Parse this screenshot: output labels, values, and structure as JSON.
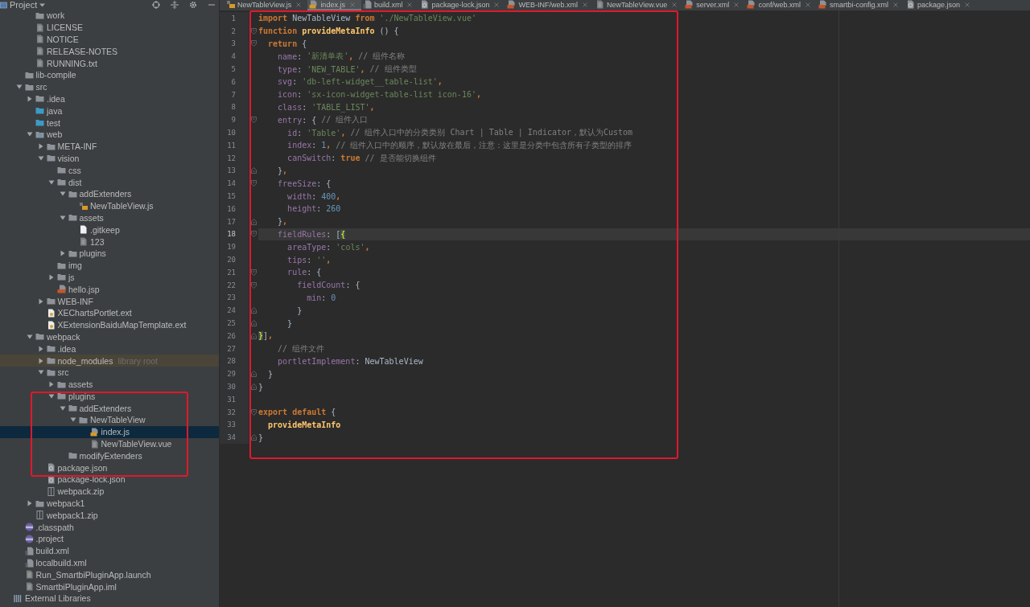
{
  "sidebar": {
    "title": "Project",
    "tree": {
      "cut_branch": [
        {
          "label": "work",
          "kind": "folder",
          "selected": false
        },
        {
          "label": "LICENSE",
          "kind": "text",
          "selected": false
        },
        {
          "label": "NOTICE",
          "kind": "text",
          "selected": false
        },
        {
          "label": "RELEASE-NOTES",
          "kind": "text",
          "selected": false
        },
        {
          "label": "RUNNING.txt",
          "kind": "text",
          "selected": false
        }
      ],
      "project_items": [
        {
          "label": "lib-compile",
          "kind": "folder",
          "selected": false
        },
        {
          "label": "src",
          "kind": "folder",
          "expanded": true,
          "selected": false,
          "children": [
            {
              "label": ".idea",
              "kind": "folder",
              "expanded": false,
              "selected": false
            },
            {
              "label": "java",
              "kind": "source-folder",
              "selected": false
            },
            {
              "label": "test",
              "kind": "source-folder",
              "selected": false
            },
            {
              "label": "web",
              "kind": "web-folder",
              "expanded": true,
              "selected": false,
              "children": [
                {
                  "label": "META-INF",
                  "kind": "folder",
                  "expanded": false,
                  "selected": false
                },
                {
                  "label": "vision",
                  "kind": "folder",
                  "expanded": true,
                  "selected": false,
                  "children": [
                    {
                      "label": "css",
                      "kind": "folder",
                      "selected": false
                    },
                    {
                      "label": "dist",
                      "kind": "folder",
                      "expanded": true,
                      "selected": false,
                      "children": [
                        {
                          "label": "addExtenders",
                          "kind": "folder",
                          "expanded": true,
                          "selected": false,
                          "children": [
                            {
                              "label": "NewTableView.js",
                              "kind": "binary",
                              "selected": false
                            }
                          ]
                        },
                        {
                          "label": "assets",
                          "kind": "folder",
                          "expanded": true,
                          "selected": false,
                          "children": [
                            {
                              "label": ".gitkeep",
                              "kind": "blank",
                              "selected": false
                            },
                            {
                              "label": "123",
                              "kind": "text",
                              "selected": false
                            }
                          ]
                        },
                        {
                          "label": "plugins",
                          "kind": "folder",
                          "expanded": false,
                          "selected": false
                        }
                      ]
                    },
                    {
                      "label": "img",
                      "kind": "folder",
                      "selected": false
                    },
                    {
                      "label": "js",
                      "kind": "folder",
                      "expanded": false,
                      "selected": false
                    },
                    {
                      "label": "hello.jsp",
                      "kind": "jsp",
                      "selected": false
                    }
                  ]
                },
                {
                  "label": "WEB-INF",
                  "kind": "folder",
                  "expanded": false,
                  "selected": false
                },
                {
                  "label": "XEChartsPortlet.ext",
                  "kind": "ext",
                  "selected": false
                },
                {
                  "label": "XExtensionBaiduMapTemplate.ext",
                  "kind": "ext",
                  "selected": false
                }
              ]
            },
            {
              "label": "webpack",
              "kind": "folder",
              "expanded": true,
              "selected": false,
              "children": [
                {
                  "label": ".idea",
                  "kind": "folder",
                  "expanded": false,
                  "selected": false
                },
                {
                  "label": "node_modules",
                  "kind": "folder",
                  "expanded": false,
                  "selected": false,
                  "note": "library root"
                },
                {
                  "label": "src",
                  "kind": "folder",
                  "expanded": true,
                  "selected": false,
                  "children": [
                    {
                      "label": "assets",
                      "kind": "folder",
                      "expanded": false,
                      "selected": false
                    },
                    {
                      "label": "plugins",
                      "kind": "folder",
                      "expanded": true,
                      "selected": false,
                      "children": [
                        {
                          "label": "addExtenders",
                          "kind": "folder",
                          "expanded": true,
                          "selected": false,
                          "children": [
                            {
                              "label": "NewTableView",
                              "kind": "folder",
                              "expanded": true,
                              "selected": false,
                              "children": [
                                {
                                  "label": "index.js",
                                  "kind": "js",
                                  "selected": true
                                },
                                {
                                  "label": "NewTableView.vue",
                                  "kind": "text",
                                  "selected": false
                                }
                              ]
                            }
                          ]
                        },
                        {
                          "label": "modifyExtenders",
                          "kind": "folder",
                          "selected": false
                        }
                      ]
                    }
                  ]
                },
                {
                  "label": "package.json",
                  "kind": "json",
                  "selected": false
                },
                {
                  "label": "package-lock.json",
                  "kind": "json",
                  "selected": false
                },
                {
                  "label": "webpack.zip",
                  "kind": "zip",
                  "selected": false
                }
              ]
            },
            {
              "label": "webpack1",
              "kind": "folder",
              "expanded": false,
              "selected": false
            },
            {
              "label": "webpack1.zip",
              "kind": "zip",
              "selected": false
            }
          ]
        },
        {
          "label": ".classpath",
          "kind": "eclipse",
          "selected": false
        },
        {
          "label": ".project",
          "kind": "eclipse",
          "selected": false
        },
        {
          "label": "build.xml",
          "kind": "build",
          "selected": false
        },
        {
          "label": "localbuild.xml",
          "kind": "build",
          "selected": false
        },
        {
          "label": "Run_SmartbiPluginApp.launch",
          "kind": "text",
          "selected": false
        },
        {
          "label": "SmartbiPluginApp.iml",
          "kind": "iml",
          "selected": false
        }
      ],
      "libraries": [
        {
          "label": "External Libraries",
          "kind": "library",
          "selected": false
        }
      ]
    }
  },
  "tabs": [
    {
      "label": "NewTableView.js",
      "kind": "binary",
      "selected": false
    },
    {
      "label": "index.js",
      "kind": "js",
      "selected": true
    },
    {
      "label": "build.xml",
      "kind": "build",
      "selected": false
    },
    {
      "label": "package-lock.json",
      "kind": "json",
      "selected": false
    },
    {
      "label": "WEB-INF/web.xml",
      "kind": "webxml",
      "selected": false
    },
    {
      "label": "NewTableView.vue",
      "kind": "text",
      "selected": false
    },
    {
      "label": "server.xml",
      "kind": "xml",
      "selected": false
    },
    {
      "label": "conf/web.xml",
      "kind": "webxml",
      "selected": false
    },
    {
      "label": "smartbi-config.xml",
      "kind": "xml",
      "selected": false
    },
    {
      "label": "package.json",
      "kind": "json",
      "selected": false
    }
  ],
  "code": {
    "lines": [
      {
        "n": "1",
        "current": false,
        "fold_open": false,
        "fold_close": false,
        "tokens": [
          {
            "kind": "kw",
            "text": "import"
          },
          {
            "kind": "txt",
            "text": " NewTableView "
          },
          {
            "kind": "kw",
            "text": "from"
          },
          {
            "kind": "str",
            "text": " './NewTableView.vue'"
          }
        ]
      },
      {
        "n": "2",
        "current": false,
        "fold_open": true,
        "fold_close": false,
        "tokens": [
          {
            "kind": "kw",
            "text": "function"
          },
          {
            "kind": "fn",
            "text": " provideMetaInfo"
          },
          {
            "kind": "txt",
            "text": " () {"
          }
        ]
      },
      {
        "n": "3",
        "current": false,
        "fold_open": true,
        "fold_close": false,
        "tokens": [
          {
            "kind": "kw",
            "text": "  return"
          },
          {
            "kind": "txt",
            "text": " {"
          }
        ]
      },
      {
        "n": "4",
        "current": false,
        "fold_open": false,
        "fold_close": false,
        "tokens": [
          {
            "kind": "prop",
            "text": "    name"
          },
          {
            "kind": "txt",
            "text": ": "
          },
          {
            "kind": "str",
            "text": "'新清单表'"
          },
          {
            "kind": "kw",
            "text": ","
          },
          {
            "kind": "com",
            "text": " // 组件名称"
          }
        ]
      },
      {
        "n": "5",
        "current": false,
        "fold_open": false,
        "fold_close": false,
        "tokens": [
          {
            "kind": "prop",
            "text": "    type"
          },
          {
            "kind": "txt",
            "text": ": "
          },
          {
            "kind": "str",
            "text": "'NEW_TABLE'"
          },
          {
            "kind": "kw",
            "text": ","
          },
          {
            "kind": "com",
            "text": " // 组件类型"
          }
        ]
      },
      {
        "n": "6",
        "current": false,
        "fold_open": false,
        "fold_close": false,
        "tokens": [
          {
            "kind": "prop",
            "text": "    svg"
          },
          {
            "kind": "txt",
            "text": ": "
          },
          {
            "kind": "str",
            "text": "'db-left-widget__table-list'"
          },
          {
            "kind": "kw",
            "text": ","
          }
        ]
      },
      {
        "n": "7",
        "current": false,
        "fold_open": false,
        "fold_close": false,
        "tokens": [
          {
            "kind": "prop",
            "text": "    icon"
          },
          {
            "kind": "txt",
            "text": ": "
          },
          {
            "kind": "str",
            "text": "'sx-icon-widget-table-list icon-16'"
          },
          {
            "kind": "kw",
            "text": ","
          }
        ]
      },
      {
        "n": "8",
        "current": false,
        "fold_open": false,
        "fold_close": false,
        "tokens": [
          {
            "kind": "prop",
            "text": "    class"
          },
          {
            "kind": "txt",
            "text": ": "
          },
          {
            "kind": "str",
            "text": "'TABLE_LIST'"
          },
          {
            "kind": "kw",
            "text": ","
          }
        ]
      },
      {
        "n": "9",
        "current": false,
        "fold_open": true,
        "fold_close": false,
        "tokens": [
          {
            "kind": "prop",
            "text": "    entry"
          },
          {
            "kind": "txt",
            "text": ": { "
          },
          {
            "kind": "com",
            "text": "// 组件入口"
          }
        ]
      },
      {
        "n": "10",
        "current": false,
        "fold_open": false,
        "fold_close": false,
        "tokens": [
          {
            "kind": "prop",
            "text": "      id"
          },
          {
            "kind": "txt",
            "text": ": "
          },
          {
            "kind": "str",
            "text": "'Table'"
          },
          {
            "kind": "kw",
            "text": ","
          },
          {
            "kind": "com",
            "text": " // 组件入口中的分类类别 Chart | Table | Indicator，默认为Custom"
          }
        ]
      },
      {
        "n": "11",
        "current": false,
        "fold_open": false,
        "fold_close": false,
        "tokens": [
          {
            "kind": "prop",
            "text": "      index"
          },
          {
            "kind": "txt",
            "text": ": "
          },
          {
            "kind": "num",
            "text": "1"
          },
          {
            "kind": "kw",
            "text": ","
          },
          {
            "kind": "com",
            "text": " // 组件入口中的顺序，默认放在最后，注意：这里是分类中包含所有子类型的排序"
          }
        ]
      },
      {
        "n": "12",
        "current": false,
        "fold_open": false,
        "fold_close": false,
        "tokens": [
          {
            "kind": "prop",
            "text": "      canSwitch"
          },
          {
            "kind": "txt",
            "text": ": "
          },
          {
            "kind": "kw",
            "text": "true"
          },
          {
            "kind": "com",
            "text": " // 是否能切换组件"
          }
        ]
      },
      {
        "n": "13",
        "current": false,
        "fold_open": false,
        "fold_close": true,
        "tokens": [
          {
            "kind": "txt",
            "text": "    }"
          },
          {
            "kind": "kw",
            "text": ","
          }
        ]
      },
      {
        "n": "14",
        "current": false,
        "fold_open": true,
        "fold_close": false,
        "tokens": [
          {
            "kind": "prop",
            "text": "    freeSize"
          },
          {
            "kind": "txt",
            "text": ": {"
          }
        ]
      },
      {
        "n": "15",
        "current": false,
        "fold_open": false,
        "fold_close": false,
        "tokens": [
          {
            "kind": "prop",
            "text": "      width"
          },
          {
            "kind": "txt",
            "text": ": "
          },
          {
            "kind": "num",
            "text": "400"
          },
          {
            "kind": "kw",
            "text": ","
          }
        ]
      },
      {
        "n": "16",
        "current": false,
        "fold_open": false,
        "fold_close": false,
        "tokens": [
          {
            "kind": "prop",
            "text": "      height"
          },
          {
            "kind": "txt",
            "text": ": "
          },
          {
            "kind": "num",
            "text": "260"
          }
        ]
      },
      {
        "n": "17",
        "current": false,
        "fold_open": false,
        "fold_close": true,
        "tokens": [
          {
            "kind": "txt",
            "text": "    }"
          },
          {
            "kind": "kw",
            "text": ","
          }
        ]
      },
      {
        "n": "18",
        "current": true,
        "fold_open": true,
        "fold_close": false,
        "tokens": [
          {
            "kind": "prop",
            "text": "    fieldRules"
          },
          {
            "kind": "txt",
            "text": ": ["
          },
          {
            "kind": "match",
            "text": "{"
          }
        ]
      },
      {
        "n": "19",
        "current": false,
        "fold_open": false,
        "fold_close": false,
        "tokens": [
          {
            "kind": "prop",
            "text": "      areaType"
          },
          {
            "kind": "txt",
            "text": ": "
          },
          {
            "kind": "str",
            "text": "'cols'"
          },
          {
            "kind": "kw",
            "text": ","
          }
        ]
      },
      {
        "n": "20",
        "current": false,
        "fold_open": false,
        "fold_close": false,
        "tokens": [
          {
            "kind": "prop",
            "text": "      tips"
          },
          {
            "kind": "txt",
            "text": ": "
          },
          {
            "kind": "str",
            "text": "''"
          },
          {
            "kind": "kw",
            "text": ","
          }
        ]
      },
      {
        "n": "21",
        "current": false,
        "fold_open": true,
        "fold_close": false,
        "tokens": [
          {
            "kind": "prop",
            "text": "      rule"
          },
          {
            "kind": "txt",
            "text": ": {"
          }
        ]
      },
      {
        "n": "22",
        "current": false,
        "fold_open": true,
        "fold_close": false,
        "tokens": [
          {
            "kind": "prop",
            "text": "        fieldCount"
          },
          {
            "kind": "txt",
            "text": ": {"
          }
        ]
      },
      {
        "n": "23",
        "current": false,
        "fold_open": false,
        "fold_close": false,
        "tokens": [
          {
            "kind": "prop",
            "text": "          min"
          },
          {
            "kind": "txt",
            "text": ": "
          },
          {
            "kind": "num",
            "text": "0"
          }
        ]
      },
      {
        "n": "24",
        "current": false,
        "fold_open": false,
        "fold_close": true,
        "tokens": [
          {
            "kind": "txt",
            "text": "        }"
          }
        ]
      },
      {
        "n": "25",
        "current": false,
        "fold_open": false,
        "fold_close": true,
        "tokens": [
          {
            "kind": "txt",
            "text": "      }"
          }
        ]
      },
      {
        "n": "26",
        "current": false,
        "fold_open": false,
        "fold_close": true,
        "tokens": [
          {
            "kind": "match",
            "text": "    }"
          },
          {
            "kind": "txt",
            "text": "]"
          },
          {
            "kind": "kw",
            "text": ","
          }
        ]
      },
      {
        "n": "27",
        "current": false,
        "fold_open": false,
        "fold_close": false,
        "tokens": [
          {
            "kind": "com",
            "text": "    // 组件文件"
          }
        ]
      },
      {
        "n": "28",
        "current": false,
        "fold_open": false,
        "fold_close": false,
        "tokens": [
          {
            "kind": "prop",
            "text": "    portletImplement"
          },
          {
            "kind": "txt",
            "text": ": NewTableView"
          }
        ]
      },
      {
        "n": "29",
        "current": false,
        "fold_open": false,
        "fold_close": true,
        "tokens": [
          {
            "kind": "txt",
            "text": "  }"
          }
        ]
      },
      {
        "n": "30",
        "current": false,
        "fold_open": false,
        "fold_close": true,
        "tokens": [
          {
            "kind": "txt",
            "text": "}"
          }
        ]
      },
      {
        "n": "31",
        "current": false,
        "fold_open": false,
        "fold_close": false
      },
      {
        "n": "32",
        "current": false,
        "fold_open": true,
        "fold_close": false,
        "tokens": [
          {
            "kind": "kw",
            "text": "export default"
          },
          {
            "kind": "txt",
            "text": " {"
          }
        ]
      },
      {
        "n": "33",
        "current": false,
        "fold_open": false,
        "fold_close": false,
        "tokens": [
          {
            "kind": "fn",
            "text": "  provideMetaInfo"
          }
        ]
      },
      {
        "n": "34",
        "current": false,
        "fold_open": false,
        "fold_close": true,
        "tokens": [
          {
            "kind": "txt",
            "text": "}"
          }
        ]
      }
    ]
  }
}
